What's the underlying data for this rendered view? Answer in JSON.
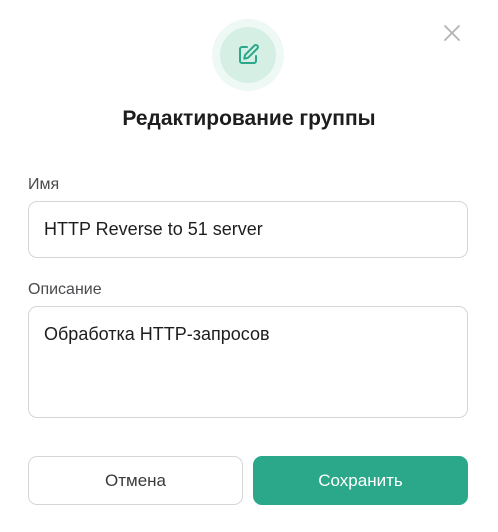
{
  "dialog": {
    "title": "Редактирование группы",
    "icon": "edit-icon",
    "close_icon": "close-icon"
  },
  "form": {
    "name_label": "Имя",
    "name_value": "HTTP Reverse to 51 server",
    "description_label": "Описание",
    "description_value": "Обработка HTTP-запросов"
  },
  "actions": {
    "cancel_label": "Отмена",
    "save_label": "Сохранить"
  },
  "colors": {
    "accent": "#2aa889",
    "icon_bg": "#d5efe5",
    "icon_halo": "#eef8f4",
    "border": "#d6d6da"
  }
}
